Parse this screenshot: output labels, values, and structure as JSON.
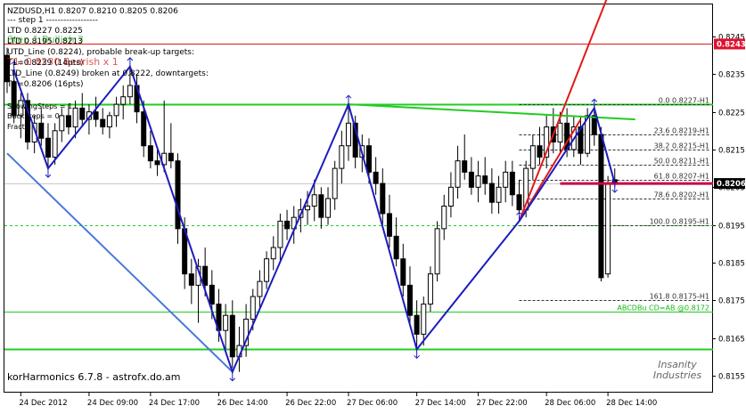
{
  "header": {
    "symbol_line": "NZDUSD,H1  0.8207 0.8210 0.8205 0.8206",
    "step_line": "---  step 1   ------------------"
  },
  "info_lines": [
    "LTD 0.8227  0.8225",
    "LTD 0.8195  0.8213",
    "UTD_Line (0.8224), probable break-up targets:",
    "T1=0.8239 (14pts)",
    "LTD_Line (0.8249) broken at 0.8222, downtargets:",
    "T1=0.8206 (16pts)"
  ],
  "overlay_labels": [
    {
      "text": "Step 1 Bullish 3",
      "color": "#19c219"
    },
    {
      "text": "T1: 0.8230 Bearish x 1",
      "color": "#d81e1e"
    }
  ],
  "side_labels": [
    "ShowingSteps = 1",
    "BackSteps = 0",
    "Fractal"
  ],
  "watermark": "korHarmonics 6.7.8 - astrofx.do.am",
  "logo": {
    "line1": "Insanity",
    "line2": "Industries"
  },
  "colors": {
    "background": "#ffffff",
    "candle": "#000000",
    "zigzag": "#1c1cbf",
    "trendline_blue": "#4a78d8",
    "trendline_green": "#22cc22",
    "trendline_red": "#e01b1b",
    "level_red": "#cc0044",
    "fib_line": "#333333",
    "level_green": "#22cc22",
    "current_price_box": "#000000",
    "red_price_box": "#e0102e"
  },
  "chart_data": {
    "type": "candlestick",
    "title": "NZDUSD,H1",
    "ylim": [
      0.81505,
      0.82535
    ],
    "xlim": [
      0,
      103
    ],
    "y_ticks": [
      "0.8245",
      "0.8235",
      "0.8225",
      "0.8215",
      "0.8205",
      "0.8195",
      "0.8185",
      "0.8175",
      "0.8165",
      "0.8155"
    ],
    "x_ticks": [
      {
        "index": 2,
        "label": "24 Dec 2012"
      },
      {
        "index": 12,
        "label": "24 Dec 09:00"
      },
      {
        "index": 21,
        "label": "24 Dec 17:00"
      },
      {
        "index": 31,
        "label": "26 Dec 14:00"
      },
      {
        "index": 41,
        "label": "26 Dec 22:00"
      },
      {
        "index": 50,
        "label": "27 Dec 06:00"
      },
      {
        "index": 60,
        "label": "27 Dec 14:00"
      },
      {
        "index": 69,
        "label": "27 Dec 22:00"
      },
      {
        "index": 79,
        "label": "28 Dec 06:00"
      },
      {
        "index": 88,
        "label": "28 Dec 14:00"
      }
    ],
    "candles": [
      [
        0.824,
        0.8242,
        0.823,
        0.8233
      ],
      [
        0.8233,
        0.8236,
        0.8222,
        0.8224
      ],
      [
        0.8224,
        0.823,
        0.8218,
        0.8228
      ],
      [
        0.8228,
        0.823,
        0.8215,
        0.8217
      ],
      [
        0.8217,
        0.8224,
        0.8214,
        0.8222
      ],
      [
        0.8222,
        0.8226,
        0.8216,
        0.8218
      ],
      [
        0.8218,
        0.8222,
        0.821,
        0.8213
      ],
      [
        0.8213,
        0.8222,
        0.8211,
        0.822
      ],
      [
        0.822,
        0.8226,
        0.8217,
        0.8224
      ],
      [
        0.8224,
        0.8227,
        0.8219,
        0.8221
      ],
      [
        0.8221,
        0.8228,
        0.8218,
        0.8226
      ],
      [
        0.8226,
        0.823,
        0.8221,
        0.8223
      ],
      [
        0.8223,
        0.8227,
        0.8219,
        0.8225
      ],
      [
        0.8225,
        0.8229,
        0.8221,
        0.8223
      ],
      [
        0.8223,
        0.8226,
        0.8219,
        0.8221
      ],
      [
        0.8221,
        0.8225,
        0.8218,
        0.8224
      ],
      [
        0.8224,
        0.8229,
        0.8221,
        0.8227
      ],
      [
        0.8227,
        0.8232,
        0.8223,
        0.8229
      ],
      [
        0.8229,
        0.8237,
        0.8227,
        0.8232
      ],
      [
        0.8232,
        0.8235,
        0.8222,
        0.8225
      ],
      [
        0.8225,
        0.8228,
        0.8213,
        0.8216
      ],
      [
        0.8216,
        0.822,
        0.821,
        0.8212
      ],
      [
        0.8212,
        0.8215,
        0.8208,
        0.8211
      ],
      [
        0.8211,
        0.8228,
        0.8209,
        0.8214
      ],
      [
        0.8214,
        0.8222,
        0.821,
        0.8212
      ],
      [
        0.8212,
        0.8214,
        0.819,
        0.8194
      ],
      [
        0.8194,
        0.8197,
        0.8178,
        0.8182
      ],
      [
        0.8182,
        0.8186,
        0.8174,
        0.8179
      ],
      [
        0.8179,
        0.8186,
        0.8169,
        0.8184
      ],
      [
        0.8184,
        0.8189,
        0.8176,
        0.8179
      ],
      [
        0.8179,
        0.8183,
        0.817,
        0.8174
      ],
      [
        0.8174,
        0.8178,
        0.8164,
        0.8167
      ],
      [
        0.8167,
        0.8174,
        0.8162,
        0.8171
      ],
      [
        0.8171,
        0.8175,
        0.8157,
        0.816
      ],
      [
        0.816,
        0.8168,
        0.8156,
        0.8163
      ],
      [
        0.8163,
        0.8174,
        0.816,
        0.817
      ],
      [
        0.817,
        0.8178,
        0.8167,
        0.8176
      ],
      [
        0.8176,
        0.8183,
        0.8173,
        0.818
      ],
      [
        0.818,
        0.8188,
        0.8178,
        0.8186
      ],
      [
        0.8186,
        0.8192,
        0.8183,
        0.8189
      ],
      [
        0.8189,
        0.8198,
        0.8185,
        0.8196
      ],
      [
        0.8196,
        0.8199,
        0.8191,
        0.8194
      ],
      [
        0.8194,
        0.82,
        0.819,
        0.8197
      ],
      [
        0.8197,
        0.8202,
        0.8193,
        0.8199
      ],
      [
        0.8199,
        0.8204,
        0.8195,
        0.82
      ],
      [
        0.82,
        0.8207,
        0.8196,
        0.8203
      ],
      [
        0.8203,
        0.8205,
        0.8194,
        0.8197
      ],
      [
        0.8197,
        0.8205,
        0.8195,
        0.8202
      ],
      [
        0.8202,
        0.8212,
        0.8199,
        0.821
      ],
      [
        0.821,
        0.822,
        0.8206,
        0.8216
      ],
      [
        0.8216,
        0.8227,
        0.8212,
        0.8222
      ],
      [
        0.8222,
        0.8224,
        0.821,
        0.8213
      ],
      [
        0.8213,
        0.8219,
        0.8209,
        0.8216
      ],
      [
        0.8216,
        0.8218,
        0.8206,
        0.8209
      ],
      [
        0.8209,
        0.8213,
        0.8203,
        0.8206
      ],
      [
        0.8206,
        0.821,
        0.8195,
        0.8198
      ],
      [
        0.8198,
        0.8203,
        0.8189,
        0.8192
      ],
      [
        0.8192,
        0.8197,
        0.8184,
        0.8186
      ],
      [
        0.8186,
        0.819,
        0.8176,
        0.8179
      ],
      [
        0.8179,
        0.8184,
        0.8168,
        0.8171
      ],
      [
        0.8171,
        0.8175,
        0.8162,
        0.8166
      ],
      [
        0.8166,
        0.8176,
        0.8163,
        0.8174
      ],
      [
        0.8174,
        0.8184,
        0.8172,
        0.8182
      ],
      [
        0.8182,
        0.8196,
        0.818,
        0.8194
      ],
      [
        0.8194,
        0.8203,
        0.8191,
        0.82
      ],
      [
        0.82,
        0.8209,
        0.8197,
        0.8205
      ],
      [
        0.8205,
        0.8216,
        0.8202,
        0.8212
      ],
      [
        0.8212,
        0.8219,
        0.8207,
        0.8209
      ],
      [
        0.8209,
        0.8213,
        0.8203,
        0.8205
      ],
      [
        0.8205,
        0.8212,
        0.8201,
        0.8208
      ],
      [
        0.8208,
        0.8213,
        0.8203,
        0.8206
      ],
      [
        0.8206,
        0.821,
        0.8198,
        0.8201
      ],
      [
        0.8201,
        0.8208,
        0.8198,
        0.8205
      ],
      [
        0.8205,
        0.8212,
        0.8201,
        0.8209
      ],
      [
        0.8209,
        0.8212,
        0.82,
        0.8203
      ],
      [
        0.8203,
        0.8207,
        0.8196,
        0.8199
      ],
      [
        0.8199,
        0.8212,
        0.8197,
        0.821
      ],
      [
        0.821,
        0.8219,
        0.8207,
        0.8216
      ],
      [
        0.8216,
        0.8221,
        0.8211,
        0.8213
      ],
      [
        0.8213,
        0.8224,
        0.821,
        0.8221
      ],
      [
        0.8221,
        0.8226,
        0.8214,
        0.8217
      ],
      [
        0.8217,
        0.8225,
        0.8214,
        0.8222
      ],
      [
        0.8222,
        0.8226,
        0.8213,
        0.8215
      ],
      [
        0.8215,
        0.8224,
        0.8213,
        0.8221
      ],
      [
        0.8221,
        0.8224,
        0.8211,
        0.8214
      ],
      [
        0.8214,
        0.8226,
        0.8213,
        0.8224
      ],
      [
        0.8224,
        0.8227,
        0.8216,
        0.8219
      ],
      [
        0.8219,
        0.8221,
        0.818,
        0.8181
      ],
      [
        0.8182,
        0.8208,
        0.8181,
        0.8206
      ],
      [
        0.8207,
        0.821,
        0.8205,
        0.8206
      ]
    ],
    "zigzag": [
      [
        1,
        0.8236
      ],
      [
        6,
        0.821
      ],
      [
        18,
        0.8237
      ],
      [
        33,
        0.8156
      ],
      [
        50,
        0.8227
      ],
      [
        60,
        0.8162
      ],
      [
        75,
        0.8196
      ],
      [
        86,
        0.8226
      ],
      [
        89,
        0.8206
      ]
    ],
    "trendlines": [
      {
        "color": "blue",
        "points": [
          [
            0,
            0.8214
          ],
          [
            33,
            0.8156
          ]
        ]
      },
      {
        "color": "green",
        "points": [
          [
            50,
            0.8227
          ],
          [
            92,
            0.8223
          ]
        ]
      },
      {
        "color": "red",
        "points": [
          [
            75,
            0.8196
          ],
          [
            90,
            0.8265
          ]
        ]
      },
      {
        "color": "red",
        "points": [
          [
            75,
            0.8196
          ],
          [
            84,
            0.8223
          ]
        ]
      }
    ],
    "fib_levels": [
      {
        "label": "0.0 0.8227-H1",
        "price": 0.8227
      },
      {
        "label": "23.6 0.8219-H1",
        "price": 0.8219
      },
      {
        "label": "38.2 0.8215-H1",
        "price": 0.8215
      },
      {
        "label": "50.0 0.8211-H1",
        "price": 0.8211
      },
      {
        "label": "61.8 0.8207-H1",
        "price": 0.8207
      },
      {
        "label": "78.6 0.8202-H1",
        "price": 0.8202
      },
      {
        "label": "100.0 0.8195-H1",
        "price": 0.8195
      },
      {
        "label": "161.8 0.8175-H1",
        "price": 0.8175
      },
      {
        "label": "ABCDBu CD=AB  @0.8172",
        "price": 0.8172
      }
    ],
    "levels": [
      {
        "name": "red-line",
        "price": 0.8243,
        "label": "0.8243"
      },
      {
        "name": "green-line-top",
        "price": 0.8227,
        "label": ""
      },
      {
        "name": "current-price",
        "price": 0.8206,
        "label": "0.8206"
      },
      {
        "name": "dashed-green",
        "price": 0.8195,
        "label": ""
      },
      {
        "name": "thin-green",
        "price": 0.8172,
        "label": ""
      },
      {
        "name": "green-line-bottom",
        "price": 0.8162,
        "label": ""
      }
    ],
    "red_segment": {
      "price": 0.8206,
      "from": 81,
      "to": 103
    }
  }
}
